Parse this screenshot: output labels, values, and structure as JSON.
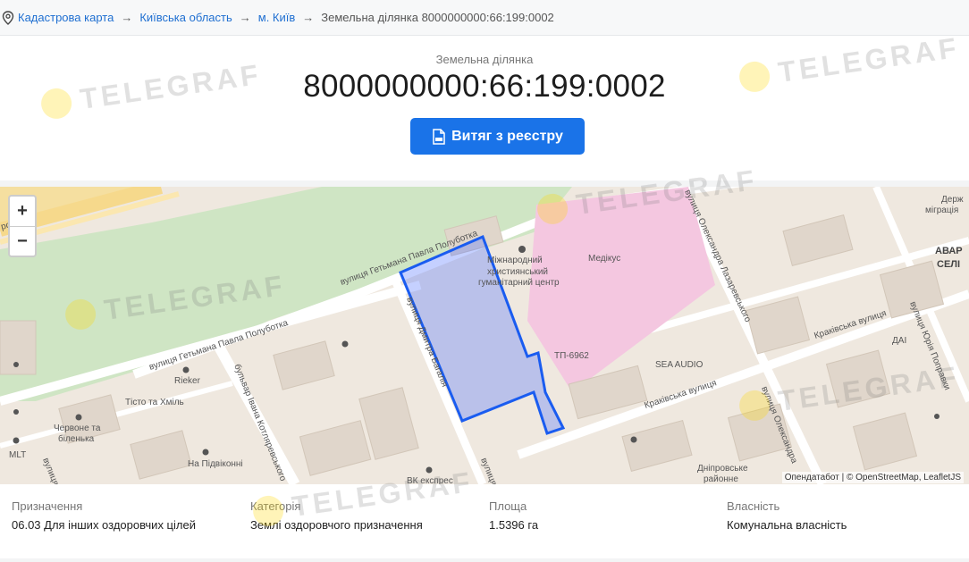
{
  "breadcrumb": {
    "items": [
      "Кадастрова карта",
      "Київська область",
      "м. Київ"
    ],
    "current": "Земельна ділянка 8000000000:66:199:0002",
    "separator": "→"
  },
  "header": {
    "subtitle": "Земельна ділянка",
    "title": "8000000000:66:199:0002",
    "button_label": "Витяг з реєстру",
    "button_color": "#1a73e8"
  },
  "map": {
    "zoom_in": "+",
    "zoom_out": "−",
    "attribution": "Опендатабот | © OpenStreetMap, LeafletJS",
    "parcel_color": "#1a5cf0",
    "labels": {
      "road_1": "вулиця Гетьмана Павла Полуботка",
      "road_2": "вулиця Гетьмана Павла Полуботка",
      "road_3": "вулиця Дмитра Багалія",
      "road_4": "вулиця Олександра Лазаревського",
      "road_5": "Краківська вулиця",
      "road_6": "Краківська вулиця",
      "road_7": "бульвар Івана Котляревського",
      "road_8": "вулиця Олександра",
      "road_9": "вулиця Юрія Поправки",
      "road_10": "вулиця",
      "road_11": "вулиця",
      "prospect": "роспект",
      "poi_1": "Міжнародний",
      "poi_1b": "християнський",
      "poi_1c": "гуманітарний центр",
      "poi_2": "Медікус",
      "poi_3": "ТП-6962",
      "poi_4": "SEA AUDIO",
      "poi_5": "Rieker",
      "poi_6": "Тісто та Хміль",
      "poi_7a": "Червоне та",
      "poi_7b": "біленька",
      "poi_8": "MLT",
      "poi_9": "На Підвіконні",
      "poi_10": "ВК експрес",
      "poi_11a": "Дніпровське",
      "poi_11b": "районне",
      "poi_12": "ДАІ",
      "poi_13a": "Держ",
      "poi_13b": "міграція",
      "poi_14a": "АВАР",
      "poi_14b": "СЕЛІ"
    }
  },
  "info": {
    "fields": [
      {
        "label": "Призначення",
        "value": "06.03 Для інших оздоровчих цілей"
      },
      {
        "label": "Категорія",
        "value": "Землі оздоровчого призначення"
      },
      {
        "label": "Площа",
        "value": "1.5396 га"
      },
      {
        "label": "Власність",
        "value": "Комунальна власність"
      }
    ]
  },
  "watermark": "TELEGRAF"
}
